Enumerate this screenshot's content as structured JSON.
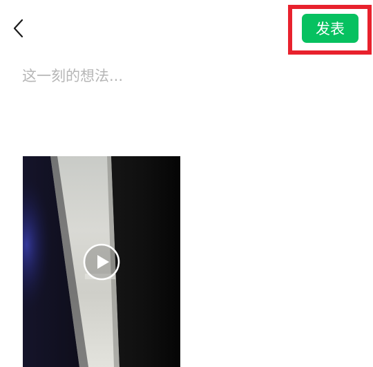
{
  "header": {
    "publish_label": "发表"
  },
  "composer": {
    "placeholder": "这一刻的想法..."
  },
  "colors": {
    "publish_green": "#07c160",
    "highlight_red": "#e8212d",
    "placeholder_gray": "#b6b6b6"
  },
  "icons": {
    "back": "chevron-left-icon",
    "play": "play-circle-icon"
  }
}
